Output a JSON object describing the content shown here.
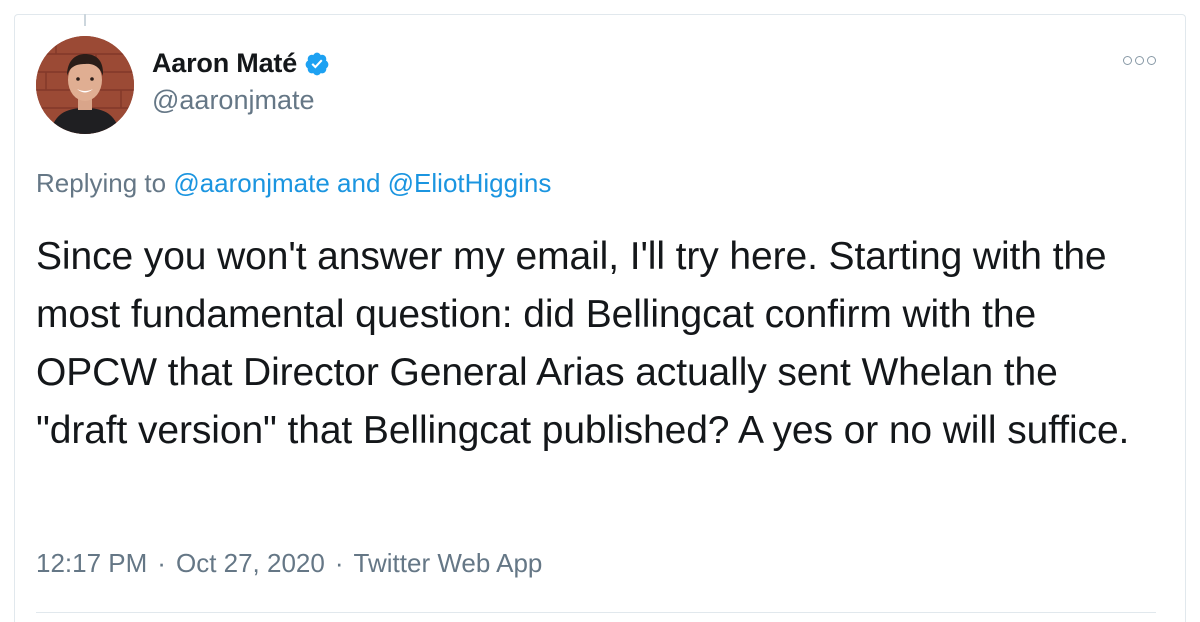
{
  "tweet": {
    "author_name": "Aaron Maté",
    "author_handle": "@aaronjmate",
    "verified": true,
    "reply_prefix": "Replying to",
    "reply_mention_1": "@aaronjmate",
    "reply_conjunction": "and",
    "reply_mention_2": "@EliotHiggins",
    "text": "Since you won't answer my email, I'll try here. Starting with the most fundamental question: did Bellingcat confirm with the OPCW that Director General Arias actually sent Whelan the \"draft version\" that Bellingcat published? A yes or no will suffice.",
    "time": "12:17 PM",
    "date": "Oct 27, 2020",
    "separator": "·",
    "source": "Twitter Web App"
  },
  "colors": {
    "link": "#1b95e0",
    "secondary_text": "#657786",
    "verified_badge": "#1da1f2"
  },
  "icons": {
    "more": "more-options-icon",
    "verified": "verified-badge-icon"
  }
}
